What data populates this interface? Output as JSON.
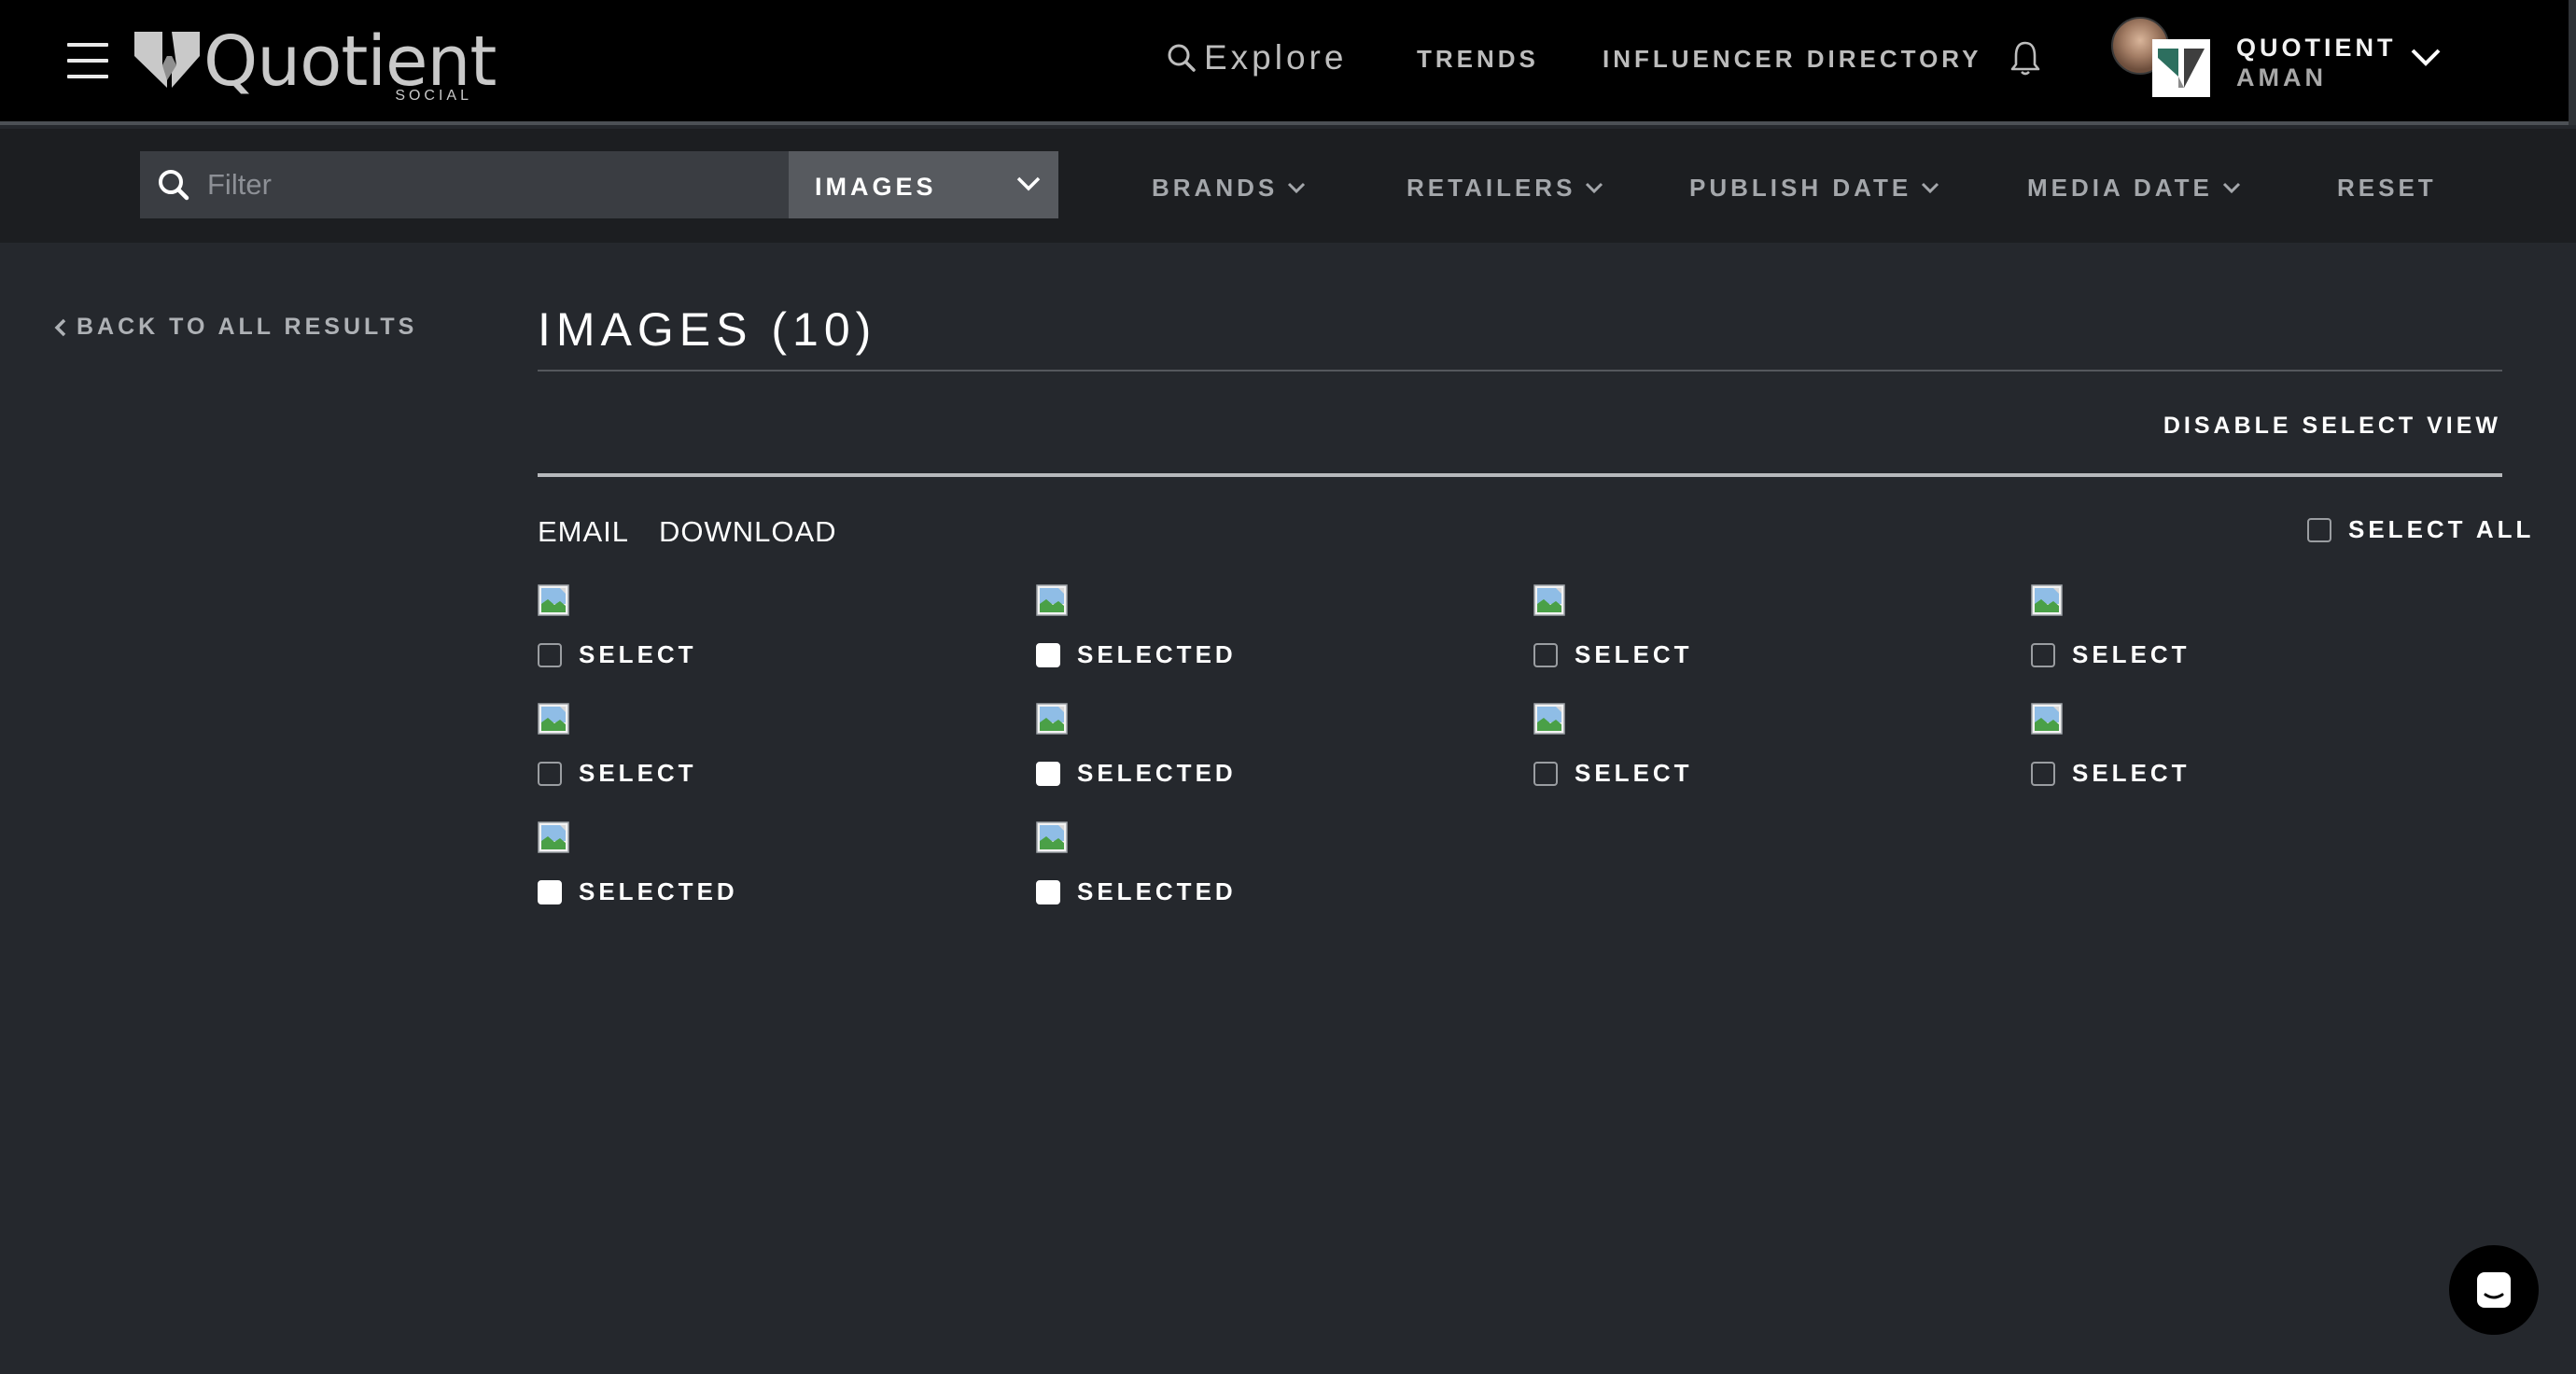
{
  "header": {
    "logo_text": "Quotient",
    "logo_subtext": "SOCIAL",
    "explore_label": "Explore",
    "nav": [
      "TRENDS",
      "INFLUENCER DIRECTORY"
    ],
    "account": {
      "name": "QUOTIENT",
      "user": "AMAN"
    }
  },
  "filter_bar": {
    "search_placeholder": "Filter",
    "type_select": "IMAGES",
    "dropdowns": [
      "BRANDS",
      "RETAILERS",
      "PUBLISH DATE",
      "MEDIA DATE"
    ],
    "reset_label": "RESET"
  },
  "main": {
    "back_label": "BACK TO ALL RESULTS",
    "title": "IMAGES (10)",
    "disable_select_view": "DISABLE SELECT VIEW",
    "actions": [
      "EMAIL",
      "DOWNLOAD"
    ],
    "select_all_label": "SELECT ALL",
    "items": [
      {
        "label": "SELECT",
        "selected": false
      },
      {
        "label": "SELECTED",
        "selected": true
      },
      {
        "label": "SELECT",
        "selected": false
      },
      {
        "label": "SELECT",
        "selected": false
      },
      {
        "label": "SELECT",
        "selected": false
      },
      {
        "label": "SELECTED",
        "selected": true
      },
      {
        "label": "SELECT",
        "selected": false
      },
      {
        "label": "SELECT",
        "selected": false
      },
      {
        "label": "SELECTED",
        "selected": true
      },
      {
        "label": "SELECTED",
        "selected": true
      }
    ]
  },
  "colors": {
    "page_bg": "#25282d",
    "header_bg": "#000000",
    "filterbar_bg": "#1c1e21",
    "select_bg": "#575a5f"
  },
  "icons": [
    "hamburger-icon",
    "quotient-logo-icon",
    "search-icon",
    "bell-icon",
    "chevron-down-icon",
    "chevron-left-icon",
    "broken-image-icon",
    "chat-icon"
  ]
}
